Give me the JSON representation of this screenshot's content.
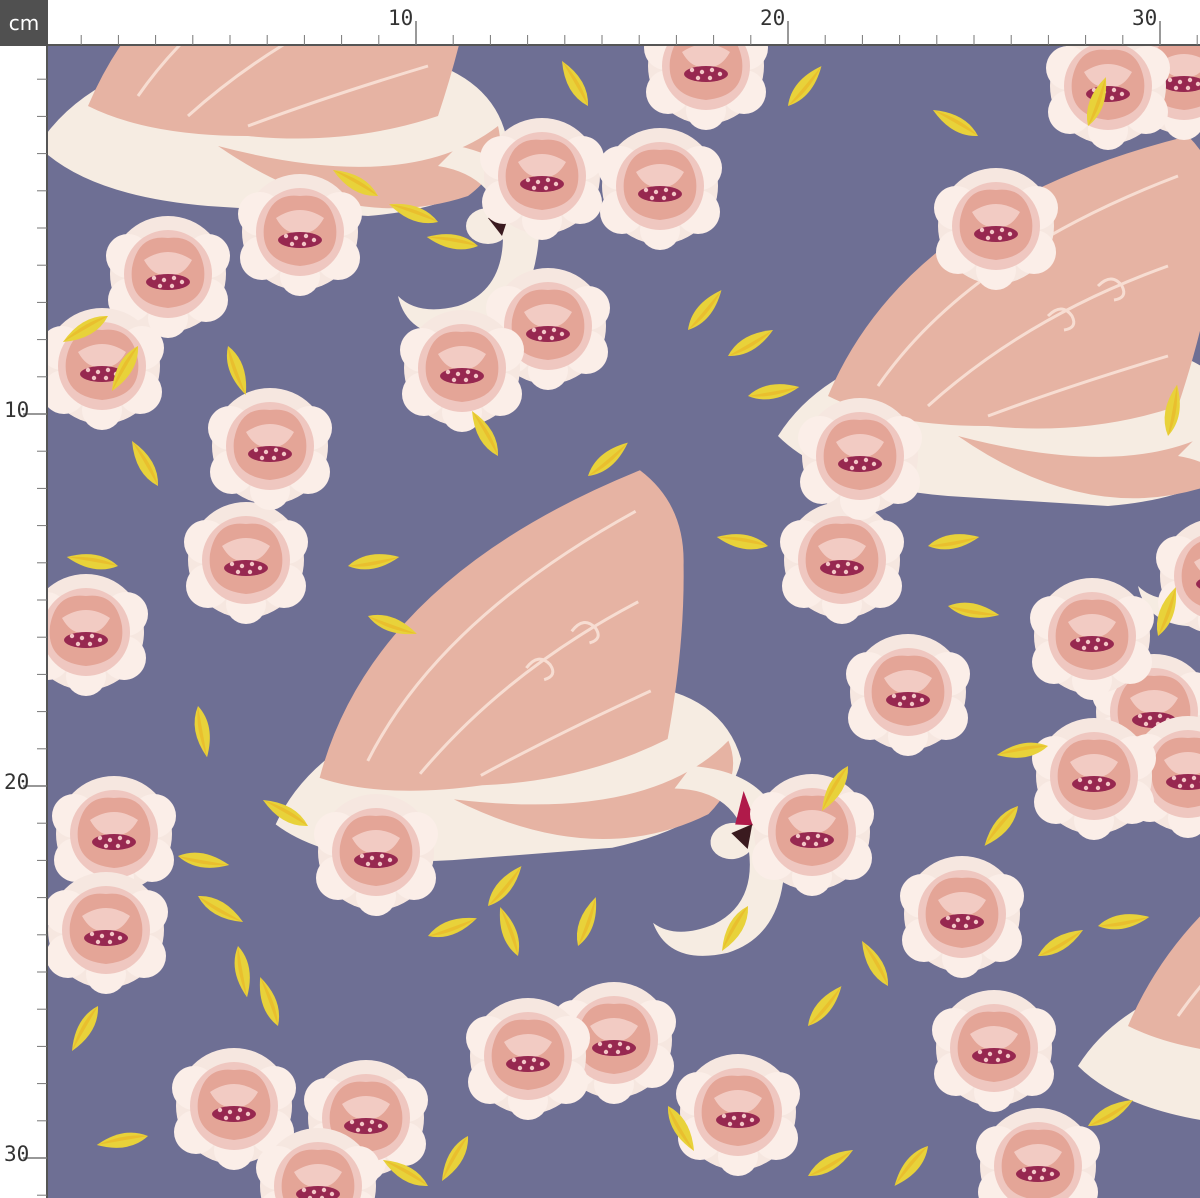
{
  "ruler": {
    "unit": "cm",
    "top_labels": [
      "10",
      "20",
      "30"
    ],
    "left_labels": [
      "10",
      "20",
      "30"
    ]
  },
  "pattern": {
    "subject": "swans-and-peonies",
    "colors": {
      "background": "#6e6f94",
      "swan_body": "#f6ece2",
      "wing": "#e6b3a3",
      "wing_shadow": "#d99a8b",
      "peony_outer": "#f3dcd6",
      "peony_inner": "#e9aaa0",
      "peony_center": "#8a1243",
      "leaf": "#e8d23a",
      "leaf_dark": "#e9b62a",
      "beak": "#b01a4a"
    }
  }
}
